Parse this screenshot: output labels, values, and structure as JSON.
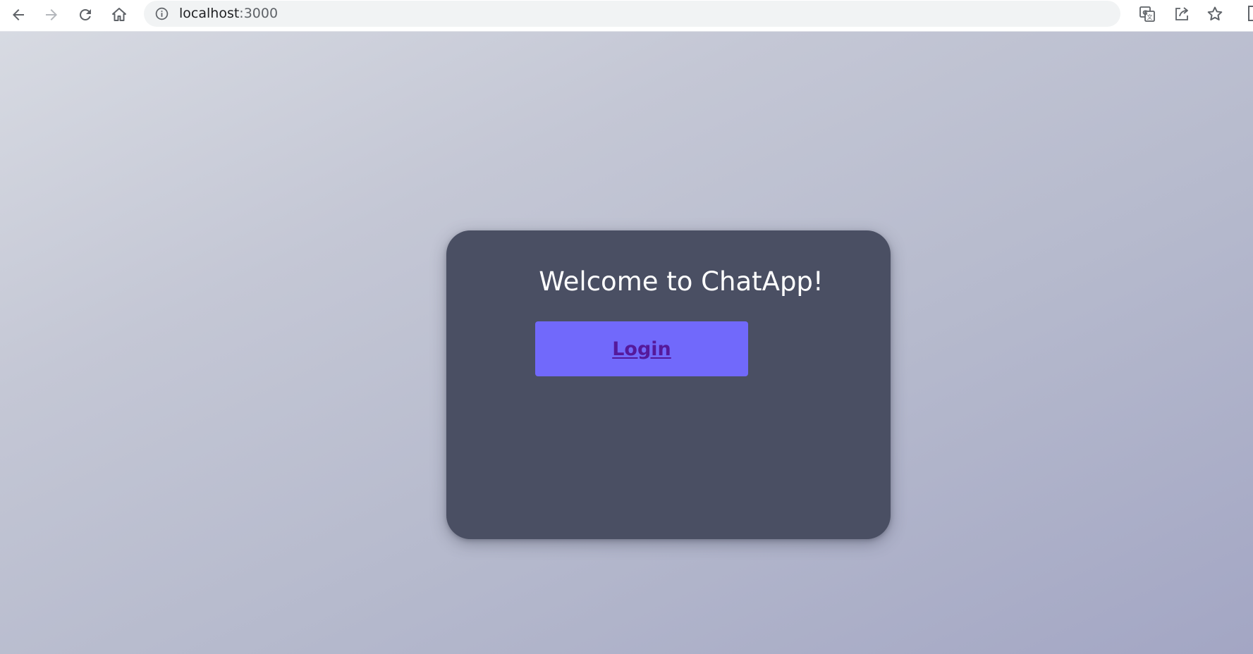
{
  "browser": {
    "address": {
      "host": "localhost",
      "port": ":3000"
    },
    "icons": {
      "back": "arrow-left-icon",
      "forward": "arrow-right-icon",
      "reload": "reload-icon",
      "home": "home-icon",
      "site_info": "info-icon",
      "translate": "translate-icon",
      "share": "share-icon",
      "bookmark": "star-icon"
    }
  },
  "page": {
    "title": "Welcome to ChatApp!",
    "login_label": "Login"
  },
  "colors": {
    "card_background": "#4a4f63",
    "button_background": "#7169fb",
    "button_text": "#55199b",
    "title_text": "#ffffff"
  }
}
